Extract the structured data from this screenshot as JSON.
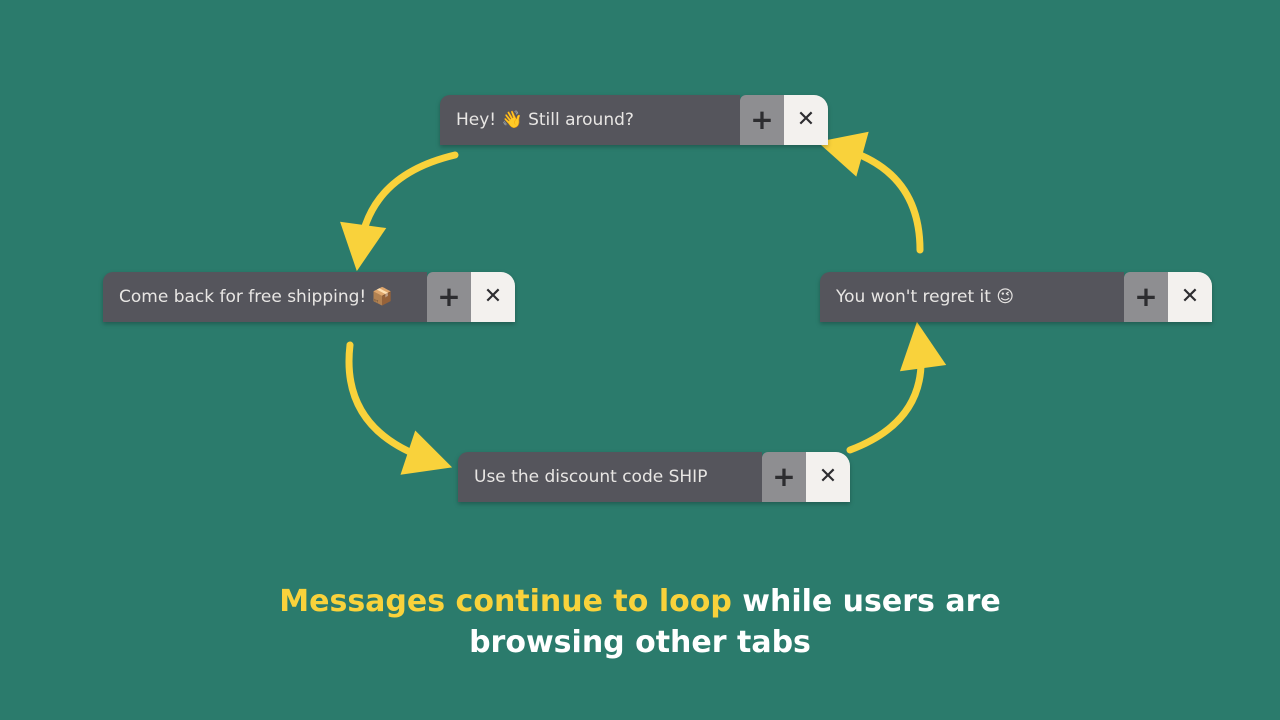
{
  "cards": [
    {
      "label": "Hey! 👋 Still around?",
      "plus": "+",
      "close": "✕"
    },
    {
      "label": "Come back for free shipping! 📦",
      "plus": "+",
      "close": "✕"
    },
    {
      "label": "Use the discount code SHIP",
      "plus": "+",
      "close": "✕"
    },
    {
      "label": "You won't regret it 😉",
      "plus": "+",
      "close": "✕"
    }
  ],
  "caption": {
    "highlight": "Messages continue to loop",
    "rest_line1": " while users are",
    "rest_line2": "browsing other tabs"
  },
  "colors": {
    "background": "#2b7b6c",
    "arrow": "#f9d23b",
    "card_body": "#55555c",
    "card_plus": "#8e8e91",
    "card_close": "#f3f1ee"
  }
}
